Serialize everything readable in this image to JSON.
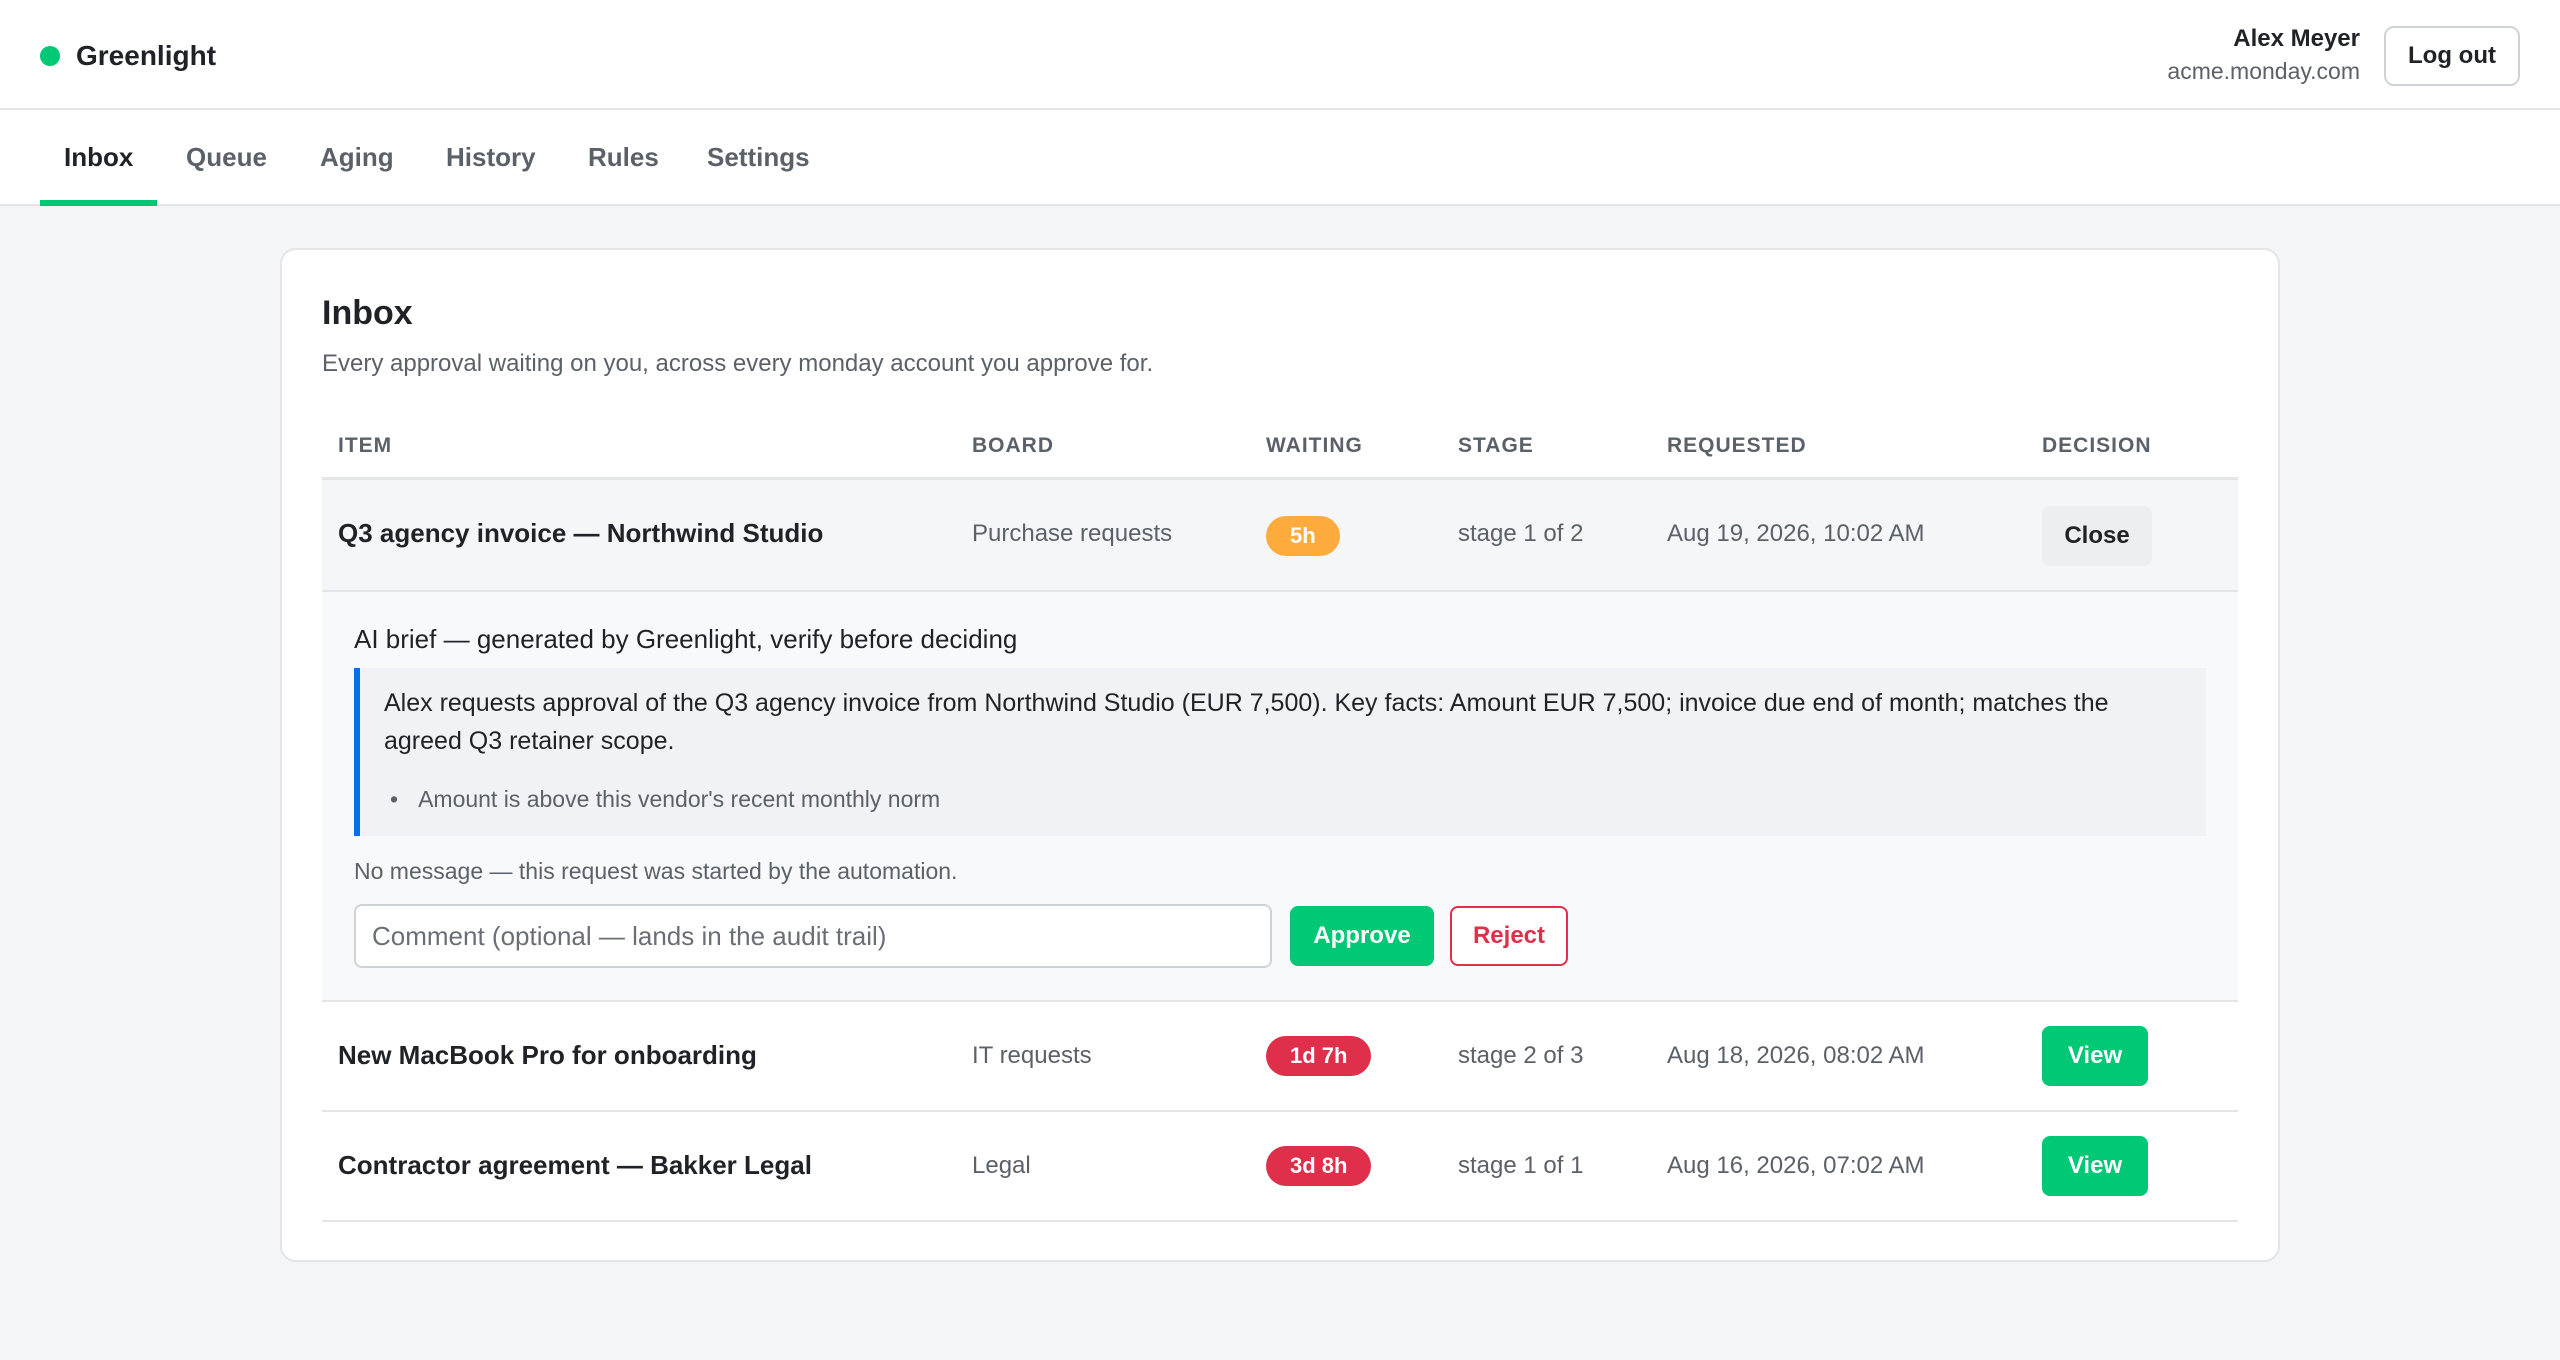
{
  "app": {
    "brand_name": "Greenlight",
    "brand_color": "#00c875",
    "brand_icon": "status-dot-icon"
  },
  "user": {
    "name": "Alex Meyer",
    "account": "acme.monday.com",
    "logout_label": "Log out"
  },
  "tabs": [
    {
      "label": "Inbox",
      "active": true
    },
    {
      "label": "Queue",
      "active": false
    },
    {
      "label": "Aging",
      "active": false
    },
    {
      "label": "History",
      "active": false
    },
    {
      "label": "Rules",
      "active": false
    },
    {
      "label": "Settings",
      "active": false
    }
  ],
  "inbox": {
    "title": "Inbox",
    "subtitle": "Every approval waiting on you, across every monday account you approve for.",
    "columns": [
      "ITEM",
      "BOARD",
      "WAITING",
      "STAGE",
      "REQUESTED",
      "DECISION"
    ],
    "rows": [
      {
        "item": "Q3 agency invoice — Northwind Studio",
        "board": "Purchase requests",
        "waiting": "5h",
        "waiting_color": "#fdab3d",
        "stage": "stage 1 of 2",
        "requested": "Aug 19, 2026, 10:02 AM",
        "decision": "Close",
        "expanded": true
      },
      {
        "item": "New MacBook Pro for onboarding",
        "board": "IT requests",
        "waiting": "1d 7h",
        "waiting_color": "#df2f4a",
        "stage": "stage 2 of 3",
        "requested": "Aug 18, 2026, 08:02 AM",
        "decision": "View",
        "expanded": false
      },
      {
        "item": "Contractor agreement — Bakker Legal",
        "board": "Legal",
        "waiting": "3d 8h",
        "waiting_color": "#df2f4a",
        "stage": "stage 1 of 1",
        "requested": "Aug 16, 2026, 07:02 AM",
        "decision": "View",
        "expanded": false
      }
    ],
    "brief": {
      "heading": "AI brief — generated by Greenlight, verify before deciding",
      "summary": "Alex requests approval of the Q3 agency invoice from Northwind Studio (EUR 7,500). Key facts: Amount EUR 7,500; invoice due end of month; matches the agreed Q3 retainer scope.",
      "bullets": [
        "Amount is above this vendor's recent monthly norm"
      ],
      "accent_color": "#0073ea",
      "no_message": "No message — this request was started by the automation.",
      "comment_placeholder": "Comment (optional — lands in the audit trail)",
      "comment_value": "",
      "approve_label": "Approve",
      "reject_label": "Reject"
    }
  }
}
